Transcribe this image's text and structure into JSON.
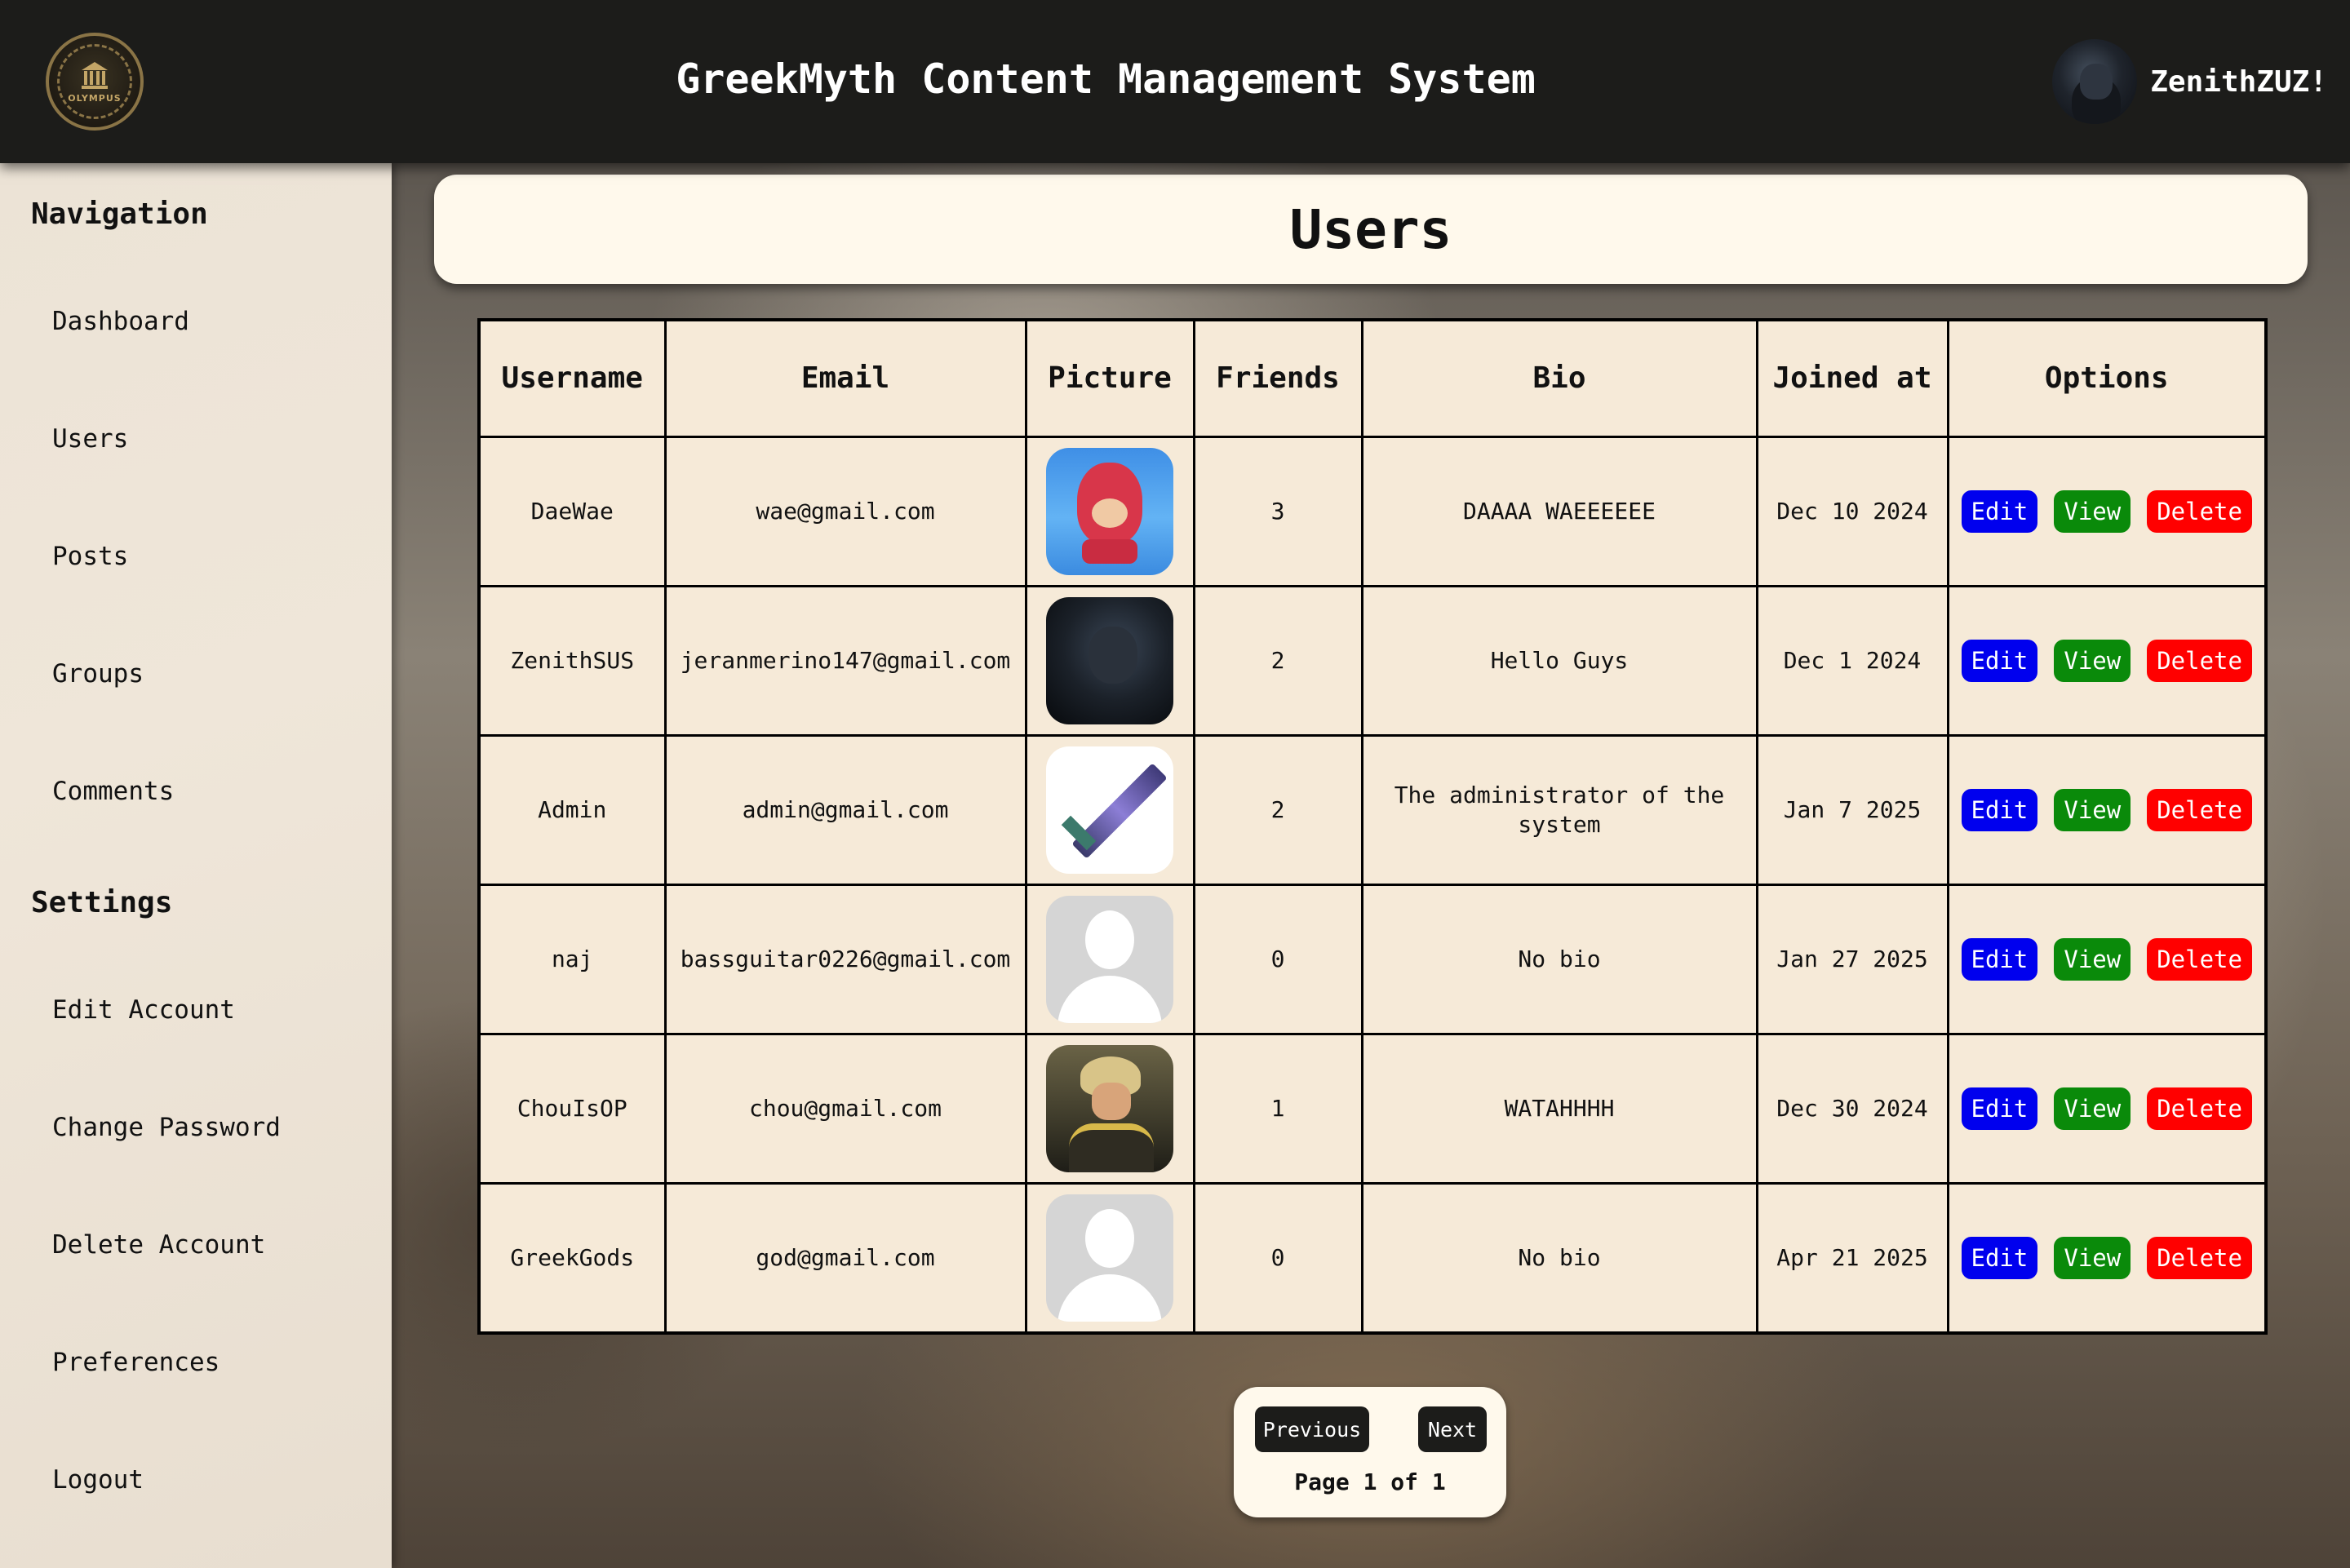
{
  "header": {
    "logo_text": "OLYMPUS",
    "title": "GreekMyth Content Management System",
    "username": "ZenithZUZ!"
  },
  "sidebar": {
    "nav_heading": "Navigation",
    "nav_items": [
      {
        "label": "Dashboard",
        "icon": null
      },
      {
        "label": "Users",
        "icon": null
      },
      {
        "label": "Posts",
        "icon": null
      },
      {
        "label": "Groups",
        "icon": null
      },
      {
        "label": "Comments",
        "icon": null
      }
    ],
    "settings_heading": "Settings",
    "settings_items": [
      {
        "label": "Edit Account"
      },
      {
        "label": "Change Password"
      },
      {
        "label": "Delete Account"
      },
      {
        "label": "Preferences"
      },
      {
        "label": "Logout"
      }
    ]
  },
  "main": {
    "page_title": "Users",
    "columns": [
      "Username",
      "Email",
      "Picture",
      "Friends",
      "Bio",
      "Joined at",
      "Options"
    ],
    "rows": [
      {
        "username": "DaeWae",
        "email": "wae@gmail.com",
        "picture": "knuckles-avatar",
        "friends": "3",
        "bio": "DAAAA WAEEEEEE",
        "joined": "Dec 10 2024"
      },
      {
        "username": "ZenithSUS",
        "email": "jeranmerino147@gmail.com",
        "picture": "dark-anime-avatar",
        "friends": "2",
        "bio": "Hello Guys",
        "joined": "Dec 1 2024"
      },
      {
        "username": "Admin",
        "email": "admin@gmail.com",
        "picture": "pixel-sword-avatar",
        "friends": "2",
        "bio": "The administrator of the system",
        "joined": "Jan 7 2025"
      },
      {
        "username": "naj",
        "email": "bassguitar0226@gmail.com",
        "picture": "default-avatar",
        "friends": "0",
        "bio": "No bio",
        "joined": "Jan 27 2025"
      },
      {
        "username": "ChouIsOP",
        "email": "chou@gmail.com",
        "picture": "hero-avatar",
        "friends": "1",
        "bio": "WATAHHHH",
        "joined": "Dec 30 2024"
      },
      {
        "username": "GreekGods",
        "email": "god@gmail.com",
        "picture": "default-avatar",
        "friends": "0",
        "bio": "No bio",
        "joined": "Apr 21 2025"
      }
    ],
    "actions": {
      "edit": "Edit",
      "view": "View",
      "delete": "Delete"
    },
    "colors": {
      "edit": "#0000ee",
      "view": "#0a8a0a",
      "delete": "#ff0000"
    }
  },
  "pagination": {
    "previous": "Previous",
    "next": "Next",
    "info": "Page 1 of 1"
  }
}
